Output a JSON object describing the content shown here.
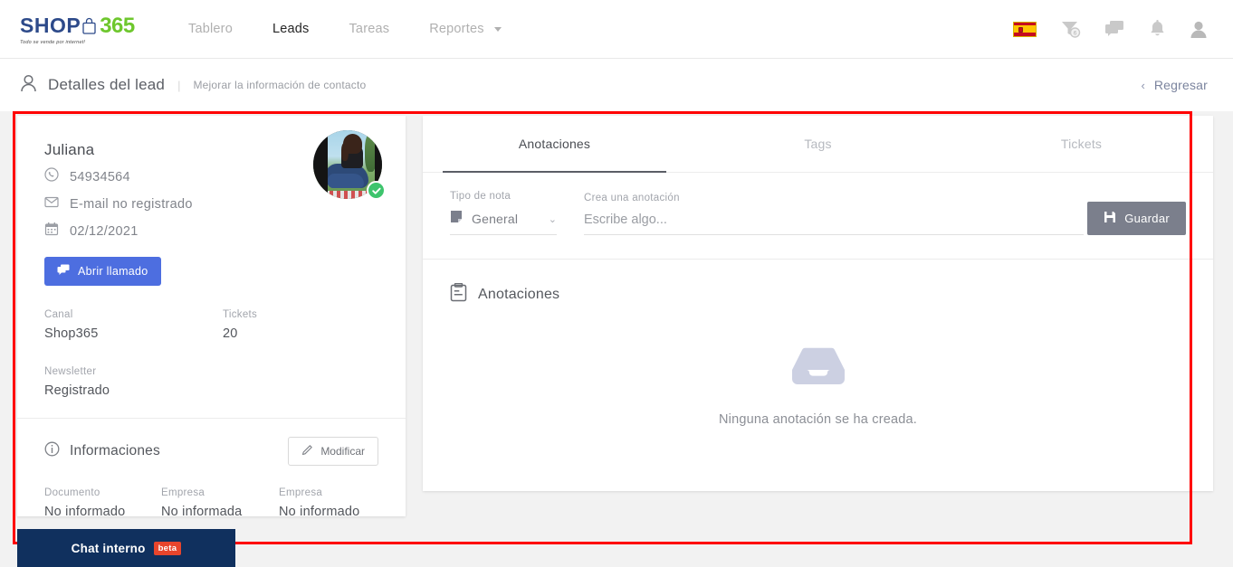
{
  "brand": {
    "logo_shop": "SHOP",
    "logo_365": "365",
    "tagline": "Todo se vende por internet!",
    "blue": "#2d4a8a",
    "green": "#6ec72d"
  },
  "nav": {
    "links": [
      {
        "label": "Tablero",
        "active": false,
        "dropdown": false
      },
      {
        "label": "Leads",
        "active": true,
        "dropdown": false
      },
      {
        "label": "Tareas",
        "active": false,
        "dropdown": false
      },
      {
        "label": "Reportes",
        "active": false,
        "dropdown": true
      }
    ],
    "icons": [
      {
        "name": "flag-es-icon",
        "label": "Español"
      },
      {
        "name": "funnel-badge-icon",
        "label": "Filtros",
        "badge": "6"
      },
      {
        "name": "chat-bubbles-icon",
        "label": "Mensajes"
      },
      {
        "name": "bell-icon",
        "label": "Notificaciones"
      },
      {
        "name": "user-icon",
        "label": "Usuario"
      }
    ]
  },
  "breadcrumb": {
    "title": "Detalles del lead",
    "separator": "|",
    "subtitle": "Mejorar la información de contacto",
    "back_label": "Regresar",
    "back_chevron": "‹"
  },
  "lead": {
    "name": "Juliana",
    "phone": "54934564",
    "email": "E-mail no registrado",
    "date": "02/12/2021",
    "call_button": "Abrir llamado",
    "verified": true,
    "fields": [
      {
        "label": "Canal",
        "value": "Shop365"
      },
      {
        "label": "Tickets",
        "value": "20"
      },
      {
        "label": "Newsletter",
        "value": "Registrado"
      }
    ]
  },
  "informaciones": {
    "title": "Informaciones",
    "edit_button": "Modificar",
    "fields": [
      {
        "label": "Documento",
        "value": "No informado"
      },
      {
        "label": "Empresa",
        "value": "No informada"
      },
      {
        "label": "Empresa",
        "value": "No informado"
      }
    ]
  },
  "panel": {
    "tabs": [
      {
        "label": "Anotaciones",
        "active": true
      },
      {
        "label": "Tags",
        "active": false
      },
      {
        "label": "Tickets",
        "active": false
      }
    ],
    "note_form": {
      "type_label": "Tipo de nota",
      "type_value": "General",
      "note_label": "Crea una anotación",
      "note_value": "",
      "note_placeholder": "Escribe algo...",
      "save_button": "Guardar"
    },
    "annotations": {
      "title": "Anotaciones",
      "empty_message": "Ninguna anotación se ha creada."
    }
  },
  "chat": {
    "label": "Chat interno",
    "badge": "beta"
  }
}
